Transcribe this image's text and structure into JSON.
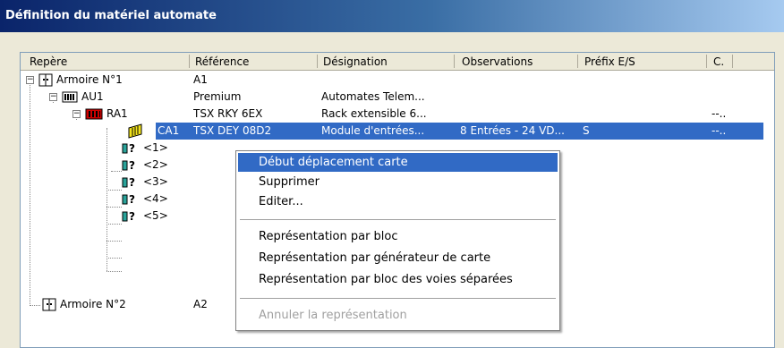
{
  "window": {
    "title": "Définition du matériel automate"
  },
  "columns": [
    "Repère",
    "Référence",
    "Désignation",
    "Observations",
    "Préfix E/S",
    "C."
  ],
  "rows": [
    {
      "repere": "Armoire N°1",
      "reference": "A1",
      "designation": "",
      "observations": "",
      "prefix": "",
      "c": ""
    },
    {
      "repere": "AU1",
      "reference": "Premium",
      "designation": "Automates Telem...",
      "observations": "",
      "prefix": "",
      "c": ""
    },
    {
      "repere": "RA1",
      "reference": "TSX RKY 6EX",
      "designation": "Rack extensible 6...",
      "observations": "",
      "prefix": "",
      "c": "--.."
    },
    {
      "repere": "CA1",
      "reference": "TSX DEY 08D2",
      "designation": "Module d'entrées...",
      "observations": "8 Entrées - 24 VD...",
      "prefix": "S",
      "c": "--.."
    },
    {
      "repere": "<1>",
      "reference": "",
      "designation": "",
      "observations": "",
      "prefix": "",
      "c": ""
    },
    {
      "repere": "<2>",
      "reference": "",
      "designation": "",
      "observations": "",
      "prefix": "",
      "c": ""
    },
    {
      "repere": "<3>",
      "reference": "",
      "designation": "",
      "observations": "",
      "prefix": "",
      "c": ""
    },
    {
      "repere": "<4>",
      "reference": "",
      "designation": "",
      "observations": "",
      "prefix": "",
      "c": ""
    },
    {
      "repere": "<5>",
      "reference": "",
      "designation": "",
      "observations": "",
      "prefix": "",
      "c": ""
    },
    {
      "repere": "Armoire N°2",
      "reference": "A2",
      "designation": "",
      "observations": "",
      "prefix": "",
      "c": ""
    }
  ],
  "context_menu": {
    "items": [
      {
        "label": "Début déplacement carte"
      },
      {
        "label": "Supprimer"
      },
      {
        "label": "Editer..."
      },
      {
        "label": "Représentation par bloc"
      },
      {
        "label": "Représentation par générateur de carte"
      },
      {
        "label": "Représentation par bloc des voies séparées"
      },
      {
        "label": "Annuler la représentation"
      }
    ]
  },
  "colors": {
    "selection": "#316ac5",
    "title_start": "#0a246a",
    "title_end": "#a6caf0"
  }
}
